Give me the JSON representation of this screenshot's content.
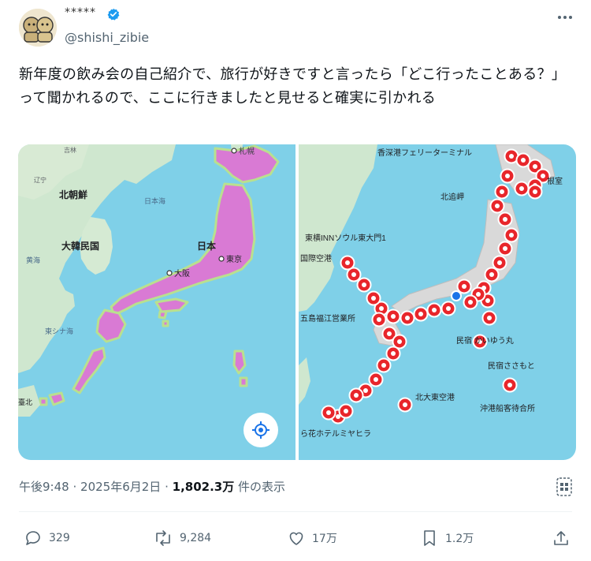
{
  "user": {
    "display_name": "*****",
    "handle": "@shishi_zibie",
    "verified_color": "#1d9bf0"
  },
  "tweet": {
    "text": "新年度の飲み会の自己紹介で、旅行が好きですと言ったら「どこ行ったことある？」って聞かれるので、ここに行きましたと見せると確実に引かれる"
  },
  "map_left": {
    "labels": {
      "sapporo": "札幌",
      "kitachosen": "北朝鮮",
      "nihonkai": "日本海",
      "kankoku": "大韓民国",
      "nihon": "日本",
      "tokyo": "東京",
      "osaka": "大阪",
      "kokai": "黄海",
      "higashishinakai": "東シナ海",
      "liaoning": "辽宁",
      "jilin": "吉林",
      "taipei": "臺北"
    },
    "location_button_icon": "my-location-icon",
    "heat_color": "#d97ad4"
  },
  "map_right": {
    "labels": {
      "ferry": "香深港フェリーターミナル",
      "nemuro": "根室",
      "hokkaido_misaki": "北追岬",
      "toyoko": "東横INNソウル東大門1",
      "kokusai_kuko": "国際空港",
      "goto": "五島福江営業所",
      "kaiyumaru": "民宿 かいゆう丸",
      "sasamoto": "民宿ささもと",
      "kitadaito": "北大東空港",
      "okinokou": "沖港船客待合所",
      "miyahira": "ら花ホテルミヤヒラ"
    },
    "pin_color": "#e8262b"
  },
  "meta": {
    "time": "午後9:48",
    "date": "2025年6月2日",
    "views": "1,802.3万",
    "views_suffix": "件の表示",
    "separator": "·"
  },
  "actions": {
    "replies": "329",
    "reposts": "9,284",
    "likes": "17万",
    "bookmarks": "1.2万"
  }
}
